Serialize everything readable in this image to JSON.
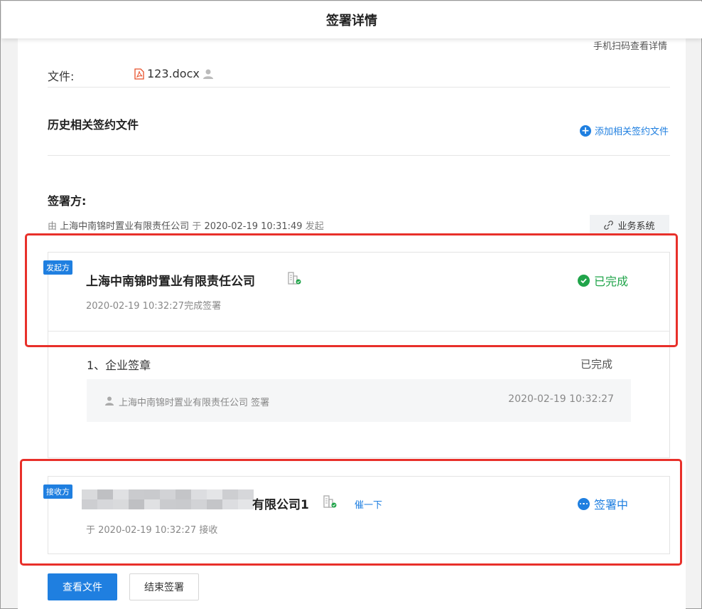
{
  "header": {
    "title": "签署详情"
  },
  "scan_link": "手机扫码查看详情",
  "file": {
    "label": "文件:",
    "name": "123.docx"
  },
  "history": {
    "title": "历史相关签约文件",
    "add_label": "添加相关签约文件"
  },
  "signers": {
    "title": "签署方:",
    "initiated_prefix": "由",
    "initiator": "上海中南锦时置业有限责任公司",
    "initiated_mid": "于",
    "initiated_time": "2020-02-19 10:31:49",
    "initiated_suffix": "发起",
    "biz_button": "业务系统"
  },
  "initiator_card": {
    "role": "发起方",
    "company": "上海中南锦时置业有限责任公司",
    "sub": "2020-02-19 10:32:27完成签署",
    "status": "已完成",
    "steps": [
      {
        "title": "1、企业签章",
        "status": "已完成",
        "record_text": "上海中南锦时置业有限责任公司 签署",
        "record_time": "2020-02-19 10:32:27"
      }
    ]
  },
  "receiver_card": {
    "role": "接收方",
    "company_visible": "有限公司1",
    "urge": "催一下",
    "sub": "于 2020-02-19 10:32:27 接收",
    "status": "签署中"
  },
  "actions": {
    "view_file": "查看文件",
    "end_sign": "结束签署"
  },
  "colors": {
    "accent": "#1f7fe0",
    "success": "#20a44a",
    "highlight": "#e8302a",
    "pdf_icon": "#e8502a"
  }
}
